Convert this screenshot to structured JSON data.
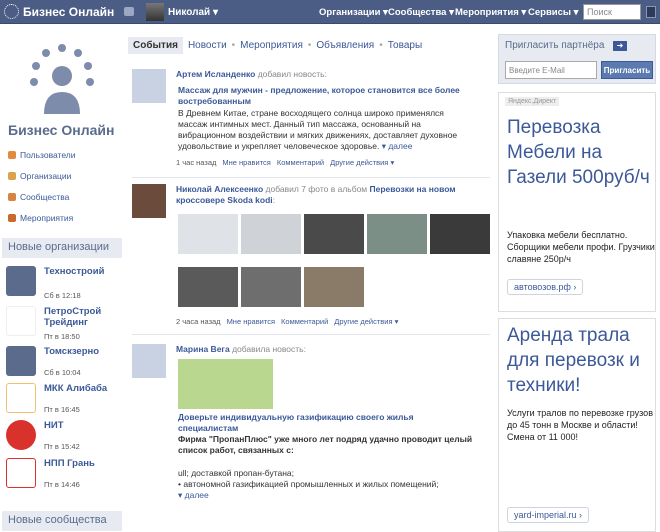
{
  "topbar": {
    "brand": "Бизнес Онлайн",
    "user": "Николай ▾",
    "menu": [
      "Организации ▾",
      "Сообщества ▾",
      "Мероприятия ▾",
      "Сервисы ▾"
    ],
    "search_placeholder": "Поиск"
  },
  "left": {
    "logo_name": "Бизнес Онлайн",
    "nav": [
      "Пользователи",
      "Организации",
      "Сообщества",
      "Мероприятия"
    ],
    "new_orgs_heading": "Новые организации",
    "orgs": [
      {
        "name": "Техностроий",
        "date": "Сб в 12:18"
      },
      {
        "name": "ПетроСтрой Трейдинг",
        "date": "Пт в 18:50"
      },
      {
        "name": "Томскзерно",
        "date": "Сб в 10:04"
      },
      {
        "name": "МКК Алибаба",
        "date": "Пт в 16:45"
      },
      {
        "name": "НИТ",
        "date": "Пт в 15:42"
      },
      {
        "name": "НПП Грань",
        "date": "Пт в 14:46"
      }
    ],
    "new_comm_heading": "Новые сообщества"
  },
  "tabs": [
    "События",
    "Новости",
    "Мероприятия",
    "Объявления",
    "Товары"
  ],
  "posts": [
    {
      "author": "Артем Исланденко",
      "action": "добавил новость:",
      "title": "Массаж для мужчин - предложение, которое становится все более востребованным",
      "body": "В Древнем Китае, стране восходящего солнца широко применялся массаж интимных мест. Данный тип массажа, основанный на вибрационном воздействии и мягких движениях, доставляет духовное удовольствие и укрепляет человеческое здоровье.",
      "more": "▾ далее",
      "time": "1 час назад",
      "like": "Мне нравится",
      "comments": "Комментарий",
      "other": "Другие действия ▾"
    },
    {
      "author": "Николай Алексеенко",
      "action": "добавил 7 фото в альбом",
      "album": "Перевозки на новом кроссовере Skoda kodi",
      "tail": ":",
      "time": "2 часа назад",
      "like": "Мне нравится",
      "comments": "Комментарий",
      "other": "Другие действия ▾"
    },
    {
      "author": "Марина Вега",
      "action": "добавила новость:",
      "title": "Доверьте индивидуальную газификацию своего жилья специалистам",
      "body_bold": "Фирма \"ПропанПлюс\" уже много лет подряд удачно проводит целый список работ, связанных с:",
      "body": "ull; доставкой пропан-бутана;\n• автономной газификацией промышленных и жилых помещений;",
      "more": "▾ далее"
    }
  ],
  "right": {
    "invite_heading": "Пригласить партнёра",
    "email_placeholder": "Введите E-Mail",
    "invite_button": "Пригласить",
    "ads": [
      {
        "label": "Яндекс.Директ",
        "title": "Перевозка Мебели на Газели 500руб/ч",
        "text": "Упаковка мебели бесплатно. Сборщики мебели профи. Грузчики славяне 250р/ч",
        "url": "автовозов.рф ›"
      },
      {
        "title": "Аренда трала для перевозк и техники!",
        "text": "Услуги тралов по перевозке грузов до 45 тонн в Москве и области! Смена от 11 000!",
        "url": "yard-imperial.ru ›"
      }
    ]
  }
}
